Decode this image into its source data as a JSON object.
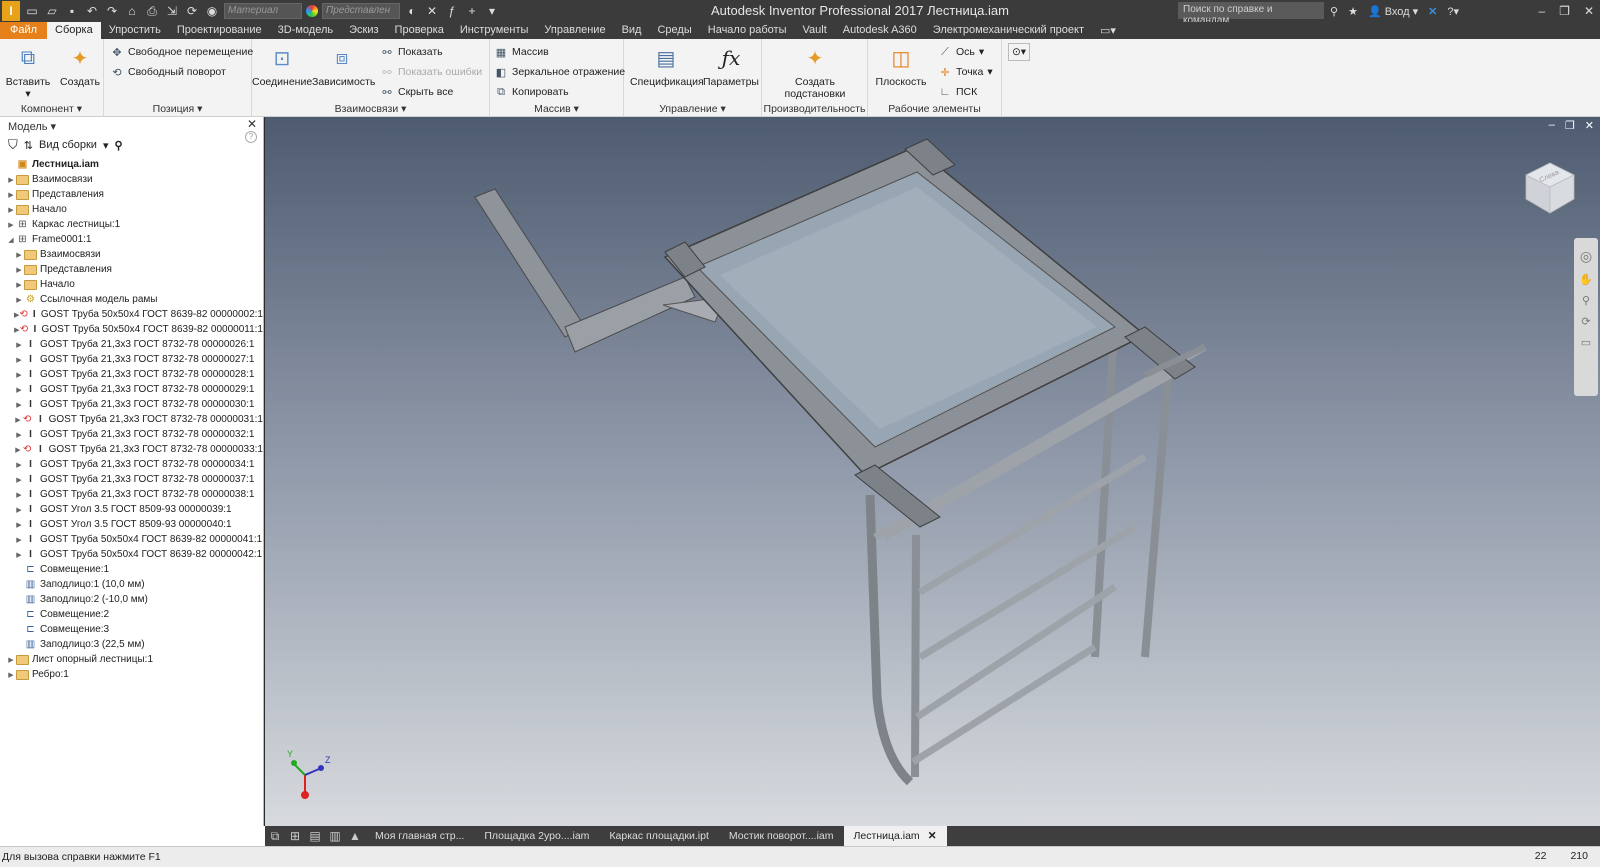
{
  "titlebar": {
    "app_logo": "I",
    "material_placeholder": "Материал",
    "appearance_placeholder": "Представлен",
    "title": "Autodesk Inventor Professional 2017    Лестница.iam",
    "help_search": "Поиск по справке и командам",
    "sign_in": "Вход"
  },
  "ribbon_tabs": [
    "Файл",
    "Сборка",
    "Упростить",
    "Проектирование",
    "3D-модель",
    "Эскиз",
    "Проверка",
    "Инструменты",
    "Управление",
    "Вид",
    "Среды",
    "Начало работы",
    "Vault",
    "Autodesk A360",
    "Электромеханический проект"
  ],
  "ribbon": {
    "component": {
      "title": "Компонент ▾",
      "insert": "Вставить",
      "create": "Создать"
    },
    "position": {
      "title": "Позиция ▾",
      "free_move": "Свободное перемещение",
      "free_rotate": "Свободный поворот"
    },
    "relationships": {
      "title": "Взаимосвязи ▾",
      "joint": "Соединение",
      "constraint": "Зависимость",
      "show": "Показать",
      "show_errors": "Показать ошибки",
      "hide_all": "Скрыть все"
    },
    "pattern": {
      "title": "Массив ▾",
      "pattern": "Массив",
      "mirror": "Зеркальное отражение",
      "copy": "Копировать"
    },
    "manage": {
      "title": "Управление ▾",
      "bom": "Спецификация",
      "parameters": "Параметры"
    },
    "productivity": {
      "title": "Производительность",
      "create_substitutes_1": "Создать",
      "create_substitutes_2": "подстановки"
    },
    "work_features": {
      "title": "Рабочие элементы",
      "plane": "Плоскость",
      "axis": "Ось",
      "point": "Точка",
      "ucs": "ПСК"
    }
  },
  "browser": {
    "title": "Модель ▾",
    "view": "Вид сборки",
    "tree": [
      {
        "level": 0,
        "icon": "assembly",
        "label": "Лестница.iam",
        "expander": "",
        "bold": true
      },
      {
        "level": 0,
        "icon": "folder",
        "label": "Взаимосвязи",
        "expander": "▶"
      },
      {
        "level": 0,
        "icon": "folder",
        "label": "Представления",
        "expander": "▶"
      },
      {
        "level": 0,
        "icon": "folder",
        "label": "Начало",
        "expander": "▶"
      },
      {
        "level": 0,
        "icon": "frame",
        "label": "Каркас лестницы:1",
        "expander": "▶"
      },
      {
        "level": 0,
        "icon": "frame",
        "label": "Frame0001:1",
        "expander": "◢"
      },
      {
        "level": 1,
        "icon": "folder",
        "label": "Взаимосвязи",
        "expander": "▶"
      },
      {
        "level": 1,
        "icon": "folder",
        "label": "Представления",
        "expander": "▶"
      },
      {
        "level": 1,
        "icon": "folder",
        "label": "Начало",
        "expander": "▶"
      },
      {
        "level": 1,
        "icon": "skeleton",
        "label": "Ссылочная модель рамы",
        "expander": "▶"
      },
      {
        "level": 1,
        "icon": "ibeam-warn",
        "label": "GOST Труба 50х50х4 ГОСТ 8639-82 00000002:1",
        "expander": "▶"
      },
      {
        "level": 1,
        "icon": "ibeam-warn",
        "label": "GOST Труба 50х50х4 ГОСТ 8639-82 00000011:1",
        "expander": "▶"
      },
      {
        "level": 1,
        "icon": "ibeam",
        "label": "GOST Труба 21,3х3 ГОСТ 8732-78 00000026:1",
        "expander": "▶"
      },
      {
        "level": 1,
        "icon": "ibeam",
        "label": "GOST Труба 21,3х3 ГОСТ 8732-78 00000027:1",
        "expander": "▶"
      },
      {
        "level": 1,
        "icon": "ibeam",
        "label": "GOST Труба 21,3х3 ГОСТ 8732-78 00000028:1",
        "expander": "▶"
      },
      {
        "level": 1,
        "icon": "ibeam",
        "label": "GOST Труба 21,3х3 ГОСТ 8732-78 00000029:1",
        "expander": "▶"
      },
      {
        "level": 1,
        "icon": "ibeam",
        "label": "GOST Труба 21,3х3 ГОСТ 8732-78 00000030:1",
        "expander": "▶"
      },
      {
        "level": 1,
        "icon": "ibeam-warn",
        "label": "GOST Труба 21,3х3 ГОСТ 8732-78 00000031:1",
        "expander": "▶"
      },
      {
        "level": 1,
        "icon": "ibeam",
        "label": "GOST Труба 21,3х3 ГОСТ 8732-78 00000032:1",
        "expander": "▶"
      },
      {
        "level": 1,
        "icon": "ibeam-warn",
        "label": "GOST Труба 21,3х3 ГОСТ 8732-78 00000033:1",
        "expander": "▶"
      },
      {
        "level": 1,
        "icon": "ibeam",
        "label": "GOST Труба 21,3х3 ГОСТ 8732-78 00000034:1",
        "expander": "▶"
      },
      {
        "level": 1,
        "icon": "ibeam",
        "label": "GOST Труба 21,3х3 ГОСТ 8732-78 00000037:1",
        "expander": "▶"
      },
      {
        "level": 1,
        "icon": "ibeam",
        "label": "GOST Труба 21,3х3 ГОСТ 8732-78 00000038:1",
        "expander": "▶"
      },
      {
        "level": 1,
        "icon": "ibeam",
        "label": "GOST Угол 3.5 ГОСТ 8509-93 00000039:1",
        "expander": "▶"
      },
      {
        "level": 1,
        "icon": "ibeam",
        "label": "GOST Угол 3.5 ГОСТ 8509-93 00000040:1",
        "expander": "▶"
      },
      {
        "level": 1,
        "icon": "ibeam",
        "label": "GOST Труба 50х50х4 ГОСТ 8639-82 00000041:1",
        "expander": "▶"
      },
      {
        "level": 1,
        "icon": "ibeam",
        "label": "GOST Труба 50х50х4 ГОСТ 8639-82 00000042:1",
        "expander": "▶"
      },
      {
        "level": 1,
        "icon": "mate",
        "label": "Совмещение:1",
        "expander": ""
      },
      {
        "level": 1,
        "icon": "flush",
        "label": "Заподлицо:1 (10,0 мм)",
        "expander": ""
      },
      {
        "level": 1,
        "icon": "flush",
        "label": "Заподлицо:2 (-10,0 мм)",
        "expander": ""
      },
      {
        "level": 1,
        "icon": "mate",
        "label": "Совмещение:2",
        "expander": ""
      },
      {
        "level": 1,
        "icon": "mate",
        "label": "Совмещение:3",
        "expander": ""
      },
      {
        "level": 1,
        "icon": "flush",
        "label": "Заподлицо:3 (22,5 мм)",
        "expander": ""
      },
      {
        "level": 0,
        "icon": "part",
        "label": "Лист опорный лестницы:1",
        "expander": "▶"
      },
      {
        "level": 0,
        "icon": "part",
        "label": "Ребро:1",
        "expander": "▶"
      }
    ]
  },
  "viewcube": {
    "label": "Слева"
  },
  "doc_tabs": [
    "Моя главная стр...",
    "Площадка 2уро....iam",
    "Каркас площадки.ipt",
    "Мостик поворот....iam",
    "Лестница.iam"
  ],
  "statusbar": {
    "text": "Для вызова справки нажмите F1",
    "value1": "22",
    "value2": "210"
  },
  "colors": {
    "file_tab": "#e5801a",
    "titlebar": "#3b3b3b",
    "ribbon": "#f3f3f3"
  }
}
